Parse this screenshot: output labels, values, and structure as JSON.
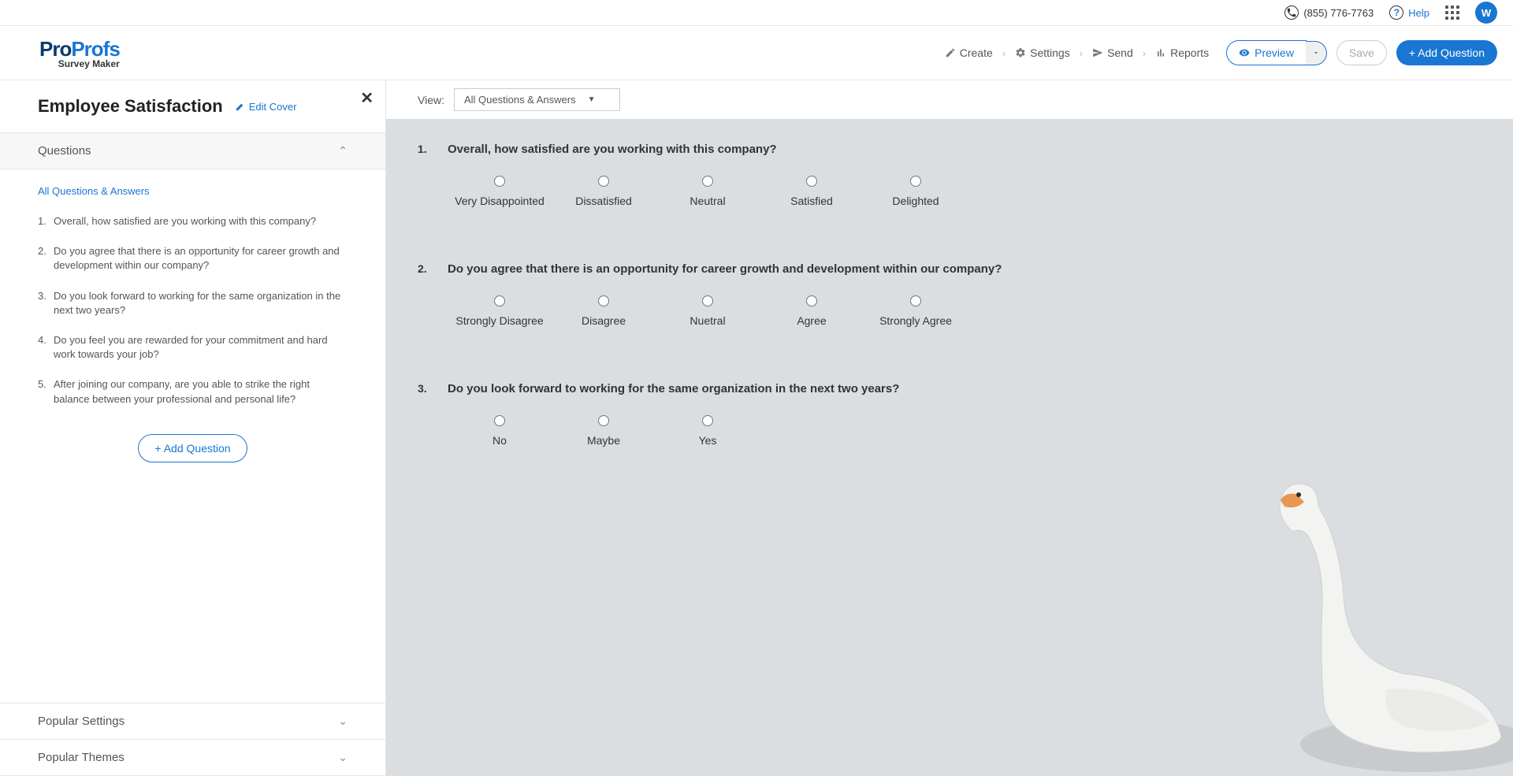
{
  "topbar": {
    "phone": "(855) 776-7763",
    "help": "Help",
    "avatar_letter": "W"
  },
  "logo": {
    "part1": "Pro",
    "part2": "Profs",
    "sub": "Survey Maker"
  },
  "nav": {
    "create": "Create",
    "settings": "Settings",
    "send": "Send",
    "reports": "Reports",
    "preview": "Preview",
    "save": "Save",
    "add_question": "+ Add Question"
  },
  "survey": {
    "title": "Employee Satisfaction",
    "edit_cover": "Edit Cover"
  },
  "sidebar": {
    "questions_header": "Questions",
    "all_qa": "All Questions & Answers",
    "add_question": "+ Add Question",
    "popular_settings": "Popular Settings",
    "popular_themes": "Popular Themes",
    "items": [
      {
        "num": "1.",
        "text": "Overall, how satisfied are you working with this company?"
      },
      {
        "num": "2.",
        "text": "Do you agree that there is an opportunity for career growth and development within our company?"
      },
      {
        "num": "3.",
        "text": "Do you look forward to working for the same organization in the next two years?"
      },
      {
        "num": "4.",
        "text": "Do you feel you are rewarded for your commitment and hard work towards your job?"
      },
      {
        "num": "5.",
        "text": "After joining our company, are you able to strike the right balance between your professional and personal life?"
      }
    ]
  },
  "view": {
    "label": "View:",
    "selected": "All Questions & Answers"
  },
  "questions": [
    {
      "num": "1.",
      "text": "Overall, how satisfied are you working with this company?",
      "options": [
        "Very Disappointed",
        "Dissatisfied",
        "Neutral",
        "Satisfied",
        "Delighted"
      ]
    },
    {
      "num": "2.",
      "text": "Do you agree that there is an opportunity for career growth and development within our company?",
      "options": [
        "Strongly Disagree",
        "Disagree",
        "Nuetral",
        "Agree",
        "Strongly Agree"
      ]
    },
    {
      "num": "3.",
      "text": "Do you look forward to working for the same organization in the next two years?",
      "options": [
        "No",
        "Maybe",
        "Yes"
      ]
    }
  ]
}
